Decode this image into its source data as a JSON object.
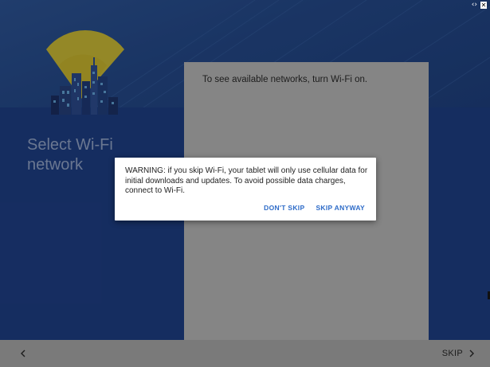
{
  "page": {
    "title": "Select Wi-Fi network"
  },
  "wifi_panel": {
    "message": "To see available networks, turn Wi-Fi on."
  },
  "dialog": {
    "message": "WARNING: if you skip Wi-Fi, your tablet will only use cellular data for initial downloads and updates. To avoid possible data charges, connect to Wi-Fi.",
    "dont_skip_label": "DON'T SKIP",
    "skip_anyway_label": "SKIP ANYWAY"
  },
  "bottom_bar": {
    "skip_label": "SKIP",
    "back_icon": "chevron-left-icon",
    "next_icon": "chevron-right-icon"
  },
  "window_controls": {
    "expand_icon": "expand-icon",
    "close_icon": "close-icon"
  },
  "colors": {
    "header": "#2d5597",
    "background": "#1e3f86",
    "panel": "#b9b9b9",
    "accent": "#2d6bc8",
    "wifi_signal": "#d6c331",
    "bottom_bar": "#7a7a7a"
  }
}
